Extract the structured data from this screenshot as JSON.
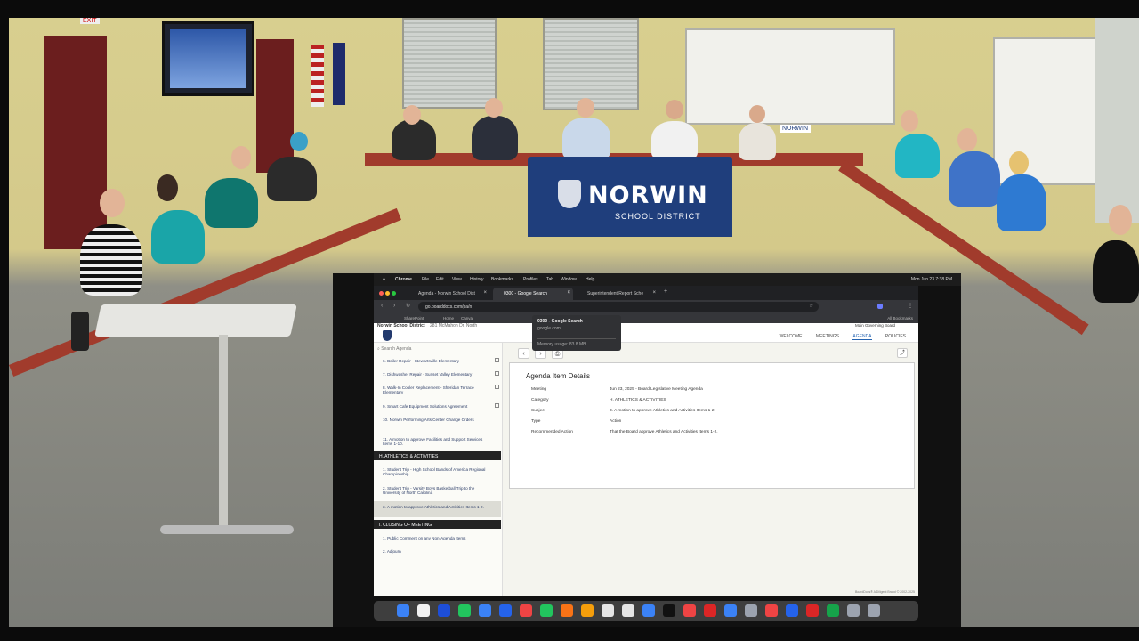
{
  "room": {
    "banner_name": "NORWIN",
    "banner_sub": "SCHOOL DISTRICT",
    "small_sign": "NORWIN",
    "exit_sign": "EXIT"
  },
  "menubar": {
    "items": [
      "Chrome",
      "File",
      "Edit",
      "View",
      "History",
      "Bookmarks",
      "Profiles",
      "Tab",
      "Window",
      "Help"
    ],
    "clock": "Mon Jun 23  7:38 PM"
  },
  "browser": {
    "tabs": [
      {
        "label": "Agenda - Norwin School Dist"
      },
      {
        "label": "0300 - Google Search"
      },
      {
        "label": "Superintendent Report Sche"
      }
    ],
    "address": "go.boarddocs.com/pa/n",
    "tooltip": {
      "title": "0300 - Google Search",
      "domain": "google.com",
      "memory": "Memory usage: 83.8 MB"
    },
    "bookmarks": [
      "SharePoint",
      "Home",
      "Canva"
    ],
    "all_bookmarks": "All Bookmarks"
  },
  "site": {
    "district": "Norwin School District",
    "address": "281 McMahon Dr, North",
    "governing": "Main Governing Board",
    "nav": [
      "WELCOME",
      "MEETINGS",
      "AGENDA",
      "POLICIES"
    ]
  },
  "sidebar": {
    "search_placeholder": "Search Agenda",
    "items": [
      "6. Boiler Repair - Stewartsville Elementary",
      "7. Dishwasher Repair - Sunset Valley Elementary",
      "8. Walk-In Cooler Replacement - Sheridan Terrace Elementary",
      "9. Smart Cafe Equipment Solutions Agreement",
      "10. Norwin Performing Arts Center Change Orders",
      "11. A motion to approve Facilities and Support Services Items 1-10."
    ],
    "section_athletics": "H. ATHLETICS & ACTIVITIES",
    "athletics_items": [
      "1. Student Trip - High School Bands of America Regional Championship",
      "2. Student Trip - Varsity Boys Basketball Trip to the University of North Carolina",
      "3. A motion to approve Athletics and Activities Items 1-2."
    ],
    "section_closing": "I. CLOSING OF MEETING",
    "closing_items": [
      "1. Public Comment on any Non-Agenda Items",
      "2. Adjourn"
    ]
  },
  "detail": {
    "title": "Agenda Item Details",
    "rows": [
      {
        "label": "Meeting",
        "value": "Jun 23, 2025 - Board Legislative Meeting Agenda"
      },
      {
        "label": "Category",
        "value": "H. ATHLETICS & ACTIVITIES"
      },
      {
        "label": "Subject",
        "value": "3. A motion to approve Athletics and Activities Items 1-2."
      },
      {
        "label": "Type",
        "value": "Action"
      },
      {
        "label": "Recommended Action",
        "value": "That the Board approve Athletics and Activities Items 1-2."
      }
    ]
  },
  "footer": "BoardDocs® A Diligent Brand © 2002-2025",
  "dock_colors": [
    "#3b82f6",
    "#f2f2f2",
    "#1d4ed8",
    "#22c55e",
    "#3b82f6",
    "#2563eb",
    "#ef4444",
    "#22c55e",
    "#f97316",
    "#f59e0b",
    "#e5e5e5",
    "#e5e5e5",
    "#3b82f6",
    "#111111",
    "#ef4444",
    "#dc2626",
    "#3b82f6",
    "#9ca3af",
    "#ef4444",
    "#2563eb",
    "#dc2626",
    "#16a34a",
    "#9ca3af",
    "#9ca3af"
  ]
}
